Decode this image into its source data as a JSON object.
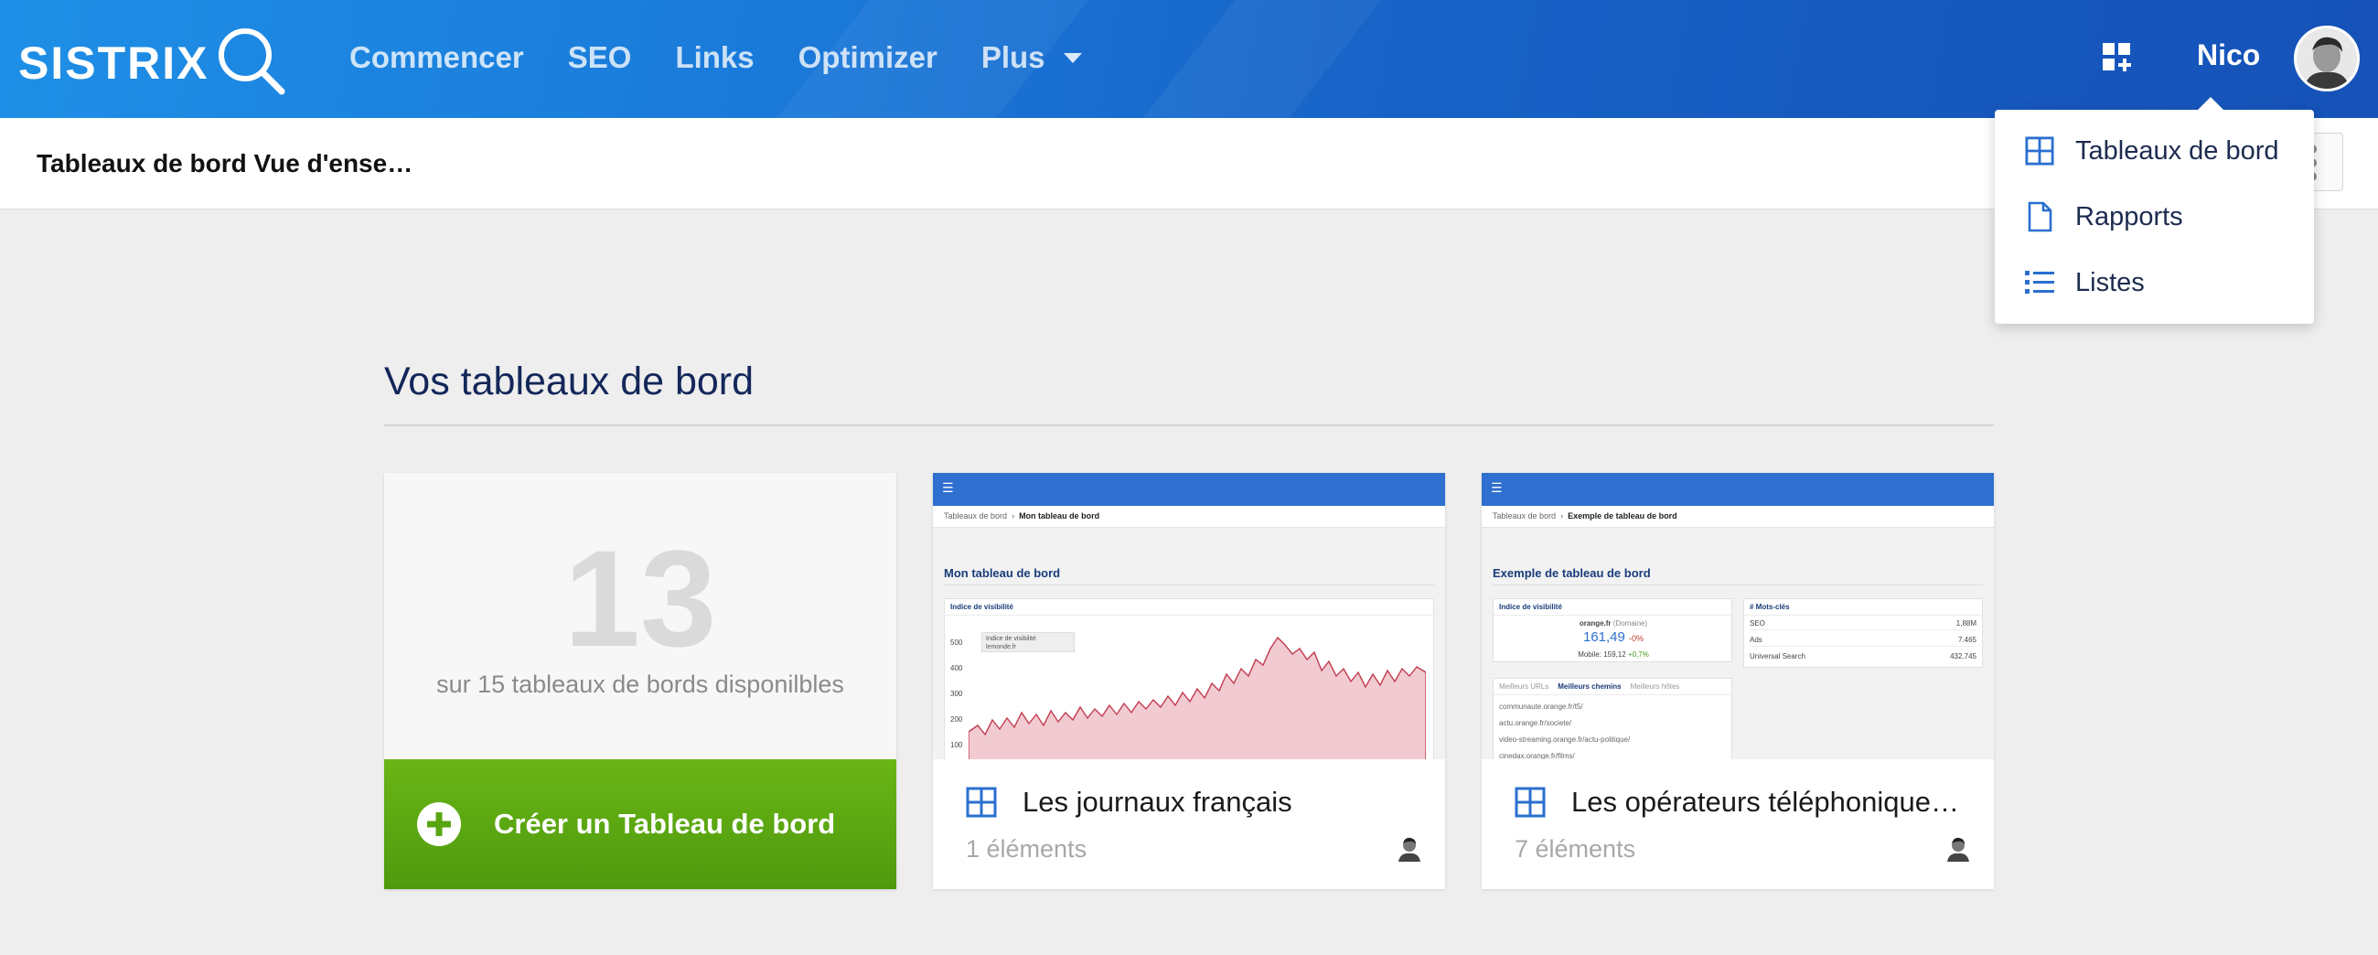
{
  "header": {
    "logo": "SISTRIX",
    "nav": [
      {
        "label": "Commencer"
      },
      {
        "label": "SEO"
      },
      {
        "label": "Links"
      },
      {
        "label": "Optimizer"
      },
      {
        "label": "Plus"
      }
    ],
    "user_name": "Nico",
    "apps_icon": "grid-plus-icon"
  },
  "subheader": {
    "title": "Tableaux de bord Vue d'ense…"
  },
  "dropdown": {
    "items": [
      {
        "label": "Tableaux de bord",
        "icon": "grid-icon"
      },
      {
        "label": "Rapports",
        "icon": "document-icon"
      },
      {
        "label": "Listes",
        "icon": "list-icon"
      }
    ]
  },
  "main": {
    "section_title": "Vos tableaux de bord",
    "count_card": {
      "number": "13",
      "subtitle": "sur 15 tableaux de bords disponilbles",
      "create_label": "Créer un Tableau de bord"
    },
    "dashboards": [
      {
        "name": "Les journaux français",
        "count": "1 éléments",
        "thumb": {
          "crumb_root": "Tableaux de bord",
          "crumb_current": "Mon tableau de bord",
          "title": "Mon tableau de bord",
          "widget_title": "Indice de visibilité",
          "legend_1": "Indice de visibilité",
          "legend_2": "lemonde.fr",
          "y_ticks": [
            "500",
            "400",
            "300",
            "200",
            "100"
          ]
        }
      },
      {
        "name": "Les opérateurs téléphonique…",
        "count": "7 éléments",
        "thumb": {
          "crumb_root": "Tableaux de bord",
          "crumb_current": "Exemple de tableau de bord",
          "title": "Exemple de tableau de bord",
          "vis_title": "Indice de visibilité",
          "vis_domain": "orange.fr",
          "vis_domain_tag": "(Domaine)",
          "vis_value": "161,49",
          "vis_change": "-0%",
          "vis_mobile": "Mobile: 159,12",
          "vis_mobile_change": "+0,7%",
          "kw_title": "# Mots-clés",
          "kw_rows": [
            {
              "label": "SEO",
              "value": "1,88M"
            },
            {
              "label": "Ads",
              "value": "7.465"
            },
            {
              "label": "Universal Search",
              "value": "432.745"
            }
          ],
          "tabs": [
            "Meilleurs URLs",
            "Meilleurs chemins",
            "Meilleurs hôtes"
          ],
          "paths": [
            "communaute.orange.fr/t5/",
            "actu.orange.fr/societe/",
            "video-streaming.orange.fr/actu-politique/",
            "cinedax.orange.fr/films/"
          ]
        }
      }
    ]
  },
  "colors": {
    "header_blue": "#1a78d8",
    "create_green": "#5aa812",
    "title_navy": "#14275a"
  }
}
